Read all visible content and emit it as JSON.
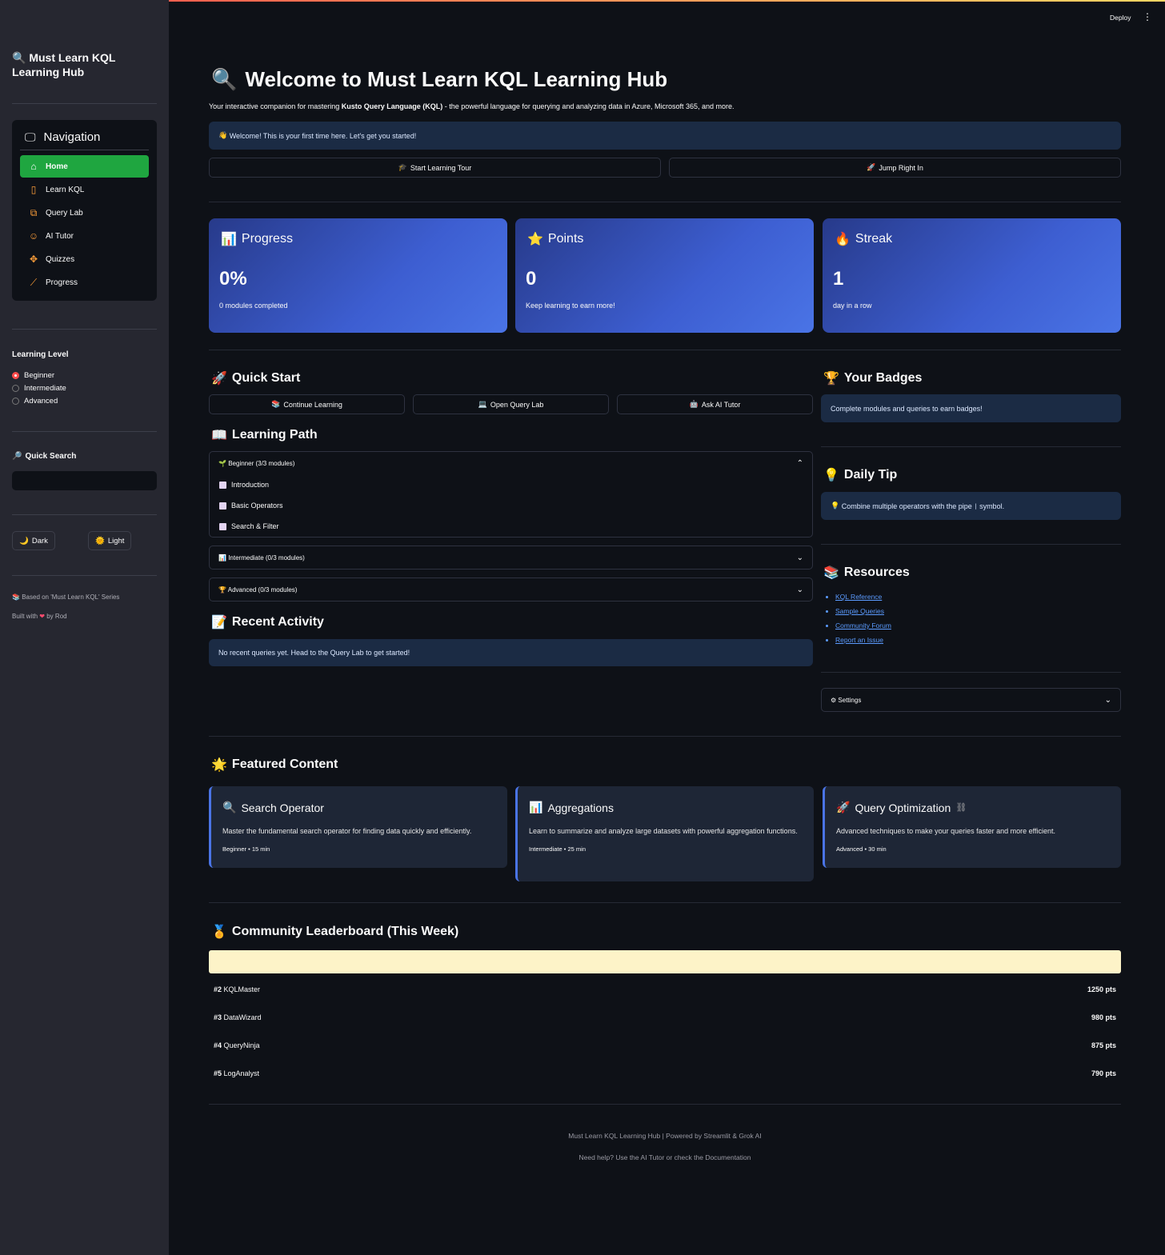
{
  "header": {
    "deploy": "Deploy"
  },
  "sidebar": {
    "title": "Must Learn KQL Learning Hub",
    "nav_title": "Navigation",
    "items": [
      {
        "label": "Home",
        "icon": "home-icon",
        "active": true
      },
      {
        "label": "Learn KQL",
        "icon": "book-icon",
        "active": false
      },
      {
        "label": "Query Lab",
        "icon": "code-icon",
        "active": false
      },
      {
        "label": "AI Tutor",
        "icon": "robot-icon",
        "active": false
      },
      {
        "label": "Quizzes",
        "icon": "puzzle-icon",
        "active": false
      },
      {
        "label": "Progress",
        "icon": "chart-icon",
        "active": false
      }
    ],
    "level_label": "Learning Level",
    "levels": [
      "Beginner",
      "Intermediate",
      "Advanced"
    ],
    "selected_level": "Beginner",
    "search_label": "Quick Search",
    "search_value": "",
    "dark_label": "Dark",
    "light_label": "Light",
    "based_on": "Based on 'Must Learn KQL' Series",
    "built_with_a": "Built with",
    "built_with_b": "by Rod"
  },
  "main": {
    "title": "Welcome to Must Learn KQL Learning Hub",
    "subtitle_a": "Your interactive companion for mastering ",
    "subtitle_b": "Kusto Query Language (KQL)",
    "subtitle_c": " - the powerful language for querying and analyzing data in Azure, Microsoft 365, and more.",
    "welcome": "Welcome! This is your first time here. Let's get you started!",
    "start_tour": "Start Learning Tour",
    "jump_in": "Jump Right In",
    "stats": [
      {
        "title": "Progress",
        "value": "0%",
        "desc": "0 modules completed"
      },
      {
        "title": "Points",
        "value": "0",
        "desc": "Keep learning to earn more!"
      },
      {
        "title": "Streak",
        "value": "1",
        "desc": "day in a row"
      }
    ],
    "quick_start": "Quick Start",
    "qs_buttons": [
      "Continue Learning",
      "Open Query Lab",
      "Ask AI Tutor"
    ],
    "learning_path": "Learning Path",
    "beginner_header": "Beginner (3/3 modules)",
    "beginner_modules": [
      "Introduction",
      "Basic Operators",
      "Search & Filter"
    ],
    "intermediate_header": "Intermediate (0/3 modules)",
    "advanced_header": "Advanced (0/3 modules)",
    "recent_activity": "Recent Activity",
    "recent_msg": "No recent queries yet. Head to the Query Lab to get started!",
    "badges_title": "Your Badges",
    "badges_msg": "Complete modules and queries to earn badges!",
    "tip_title": "Daily Tip",
    "tip_a": "Combine multiple operators with the pipe ",
    "tip_pipe": "|",
    "tip_b": " symbol.",
    "resources_title": "Resources",
    "resources": [
      "KQL Reference",
      "Sample Queries",
      "Community Forum",
      "Report an Issue"
    ],
    "settings": "Settings",
    "featured_title": "Featured Content",
    "featured": [
      {
        "title": "Search Operator",
        "desc": "Master the fundamental search operator for finding data quickly and efficiently.",
        "meta": "Beginner • 15 min"
      },
      {
        "title": "Aggregations",
        "desc": "Learn to summarize and analyze large datasets with powerful aggregation functions.",
        "meta": "Intermediate • 25 min"
      },
      {
        "title": "Query Optimization",
        "desc": "Advanced techniques to make your queries faster and more efficient.",
        "meta": "Advanced • 30 min"
      }
    ],
    "leaderboard_title": "Community Leaderboard (This Week)",
    "leaderboard": [
      {
        "rank": "#2",
        "name": "KQLMaster",
        "pts": "1250 pts"
      },
      {
        "rank": "#3",
        "name": "DataWizard",
        "pts": "980 pts"
      },
      {
        "rank": "#4",
        "name": "QueryNinja",
        "pts": "875 pts"
      },
      {
        "rank": "#5",
        "name": "LogAnalyst",
        "pts": "790 pts"
      }
    ],
    "footer_1": "Must Learn KQL Learning Hub | Powered by Streamlit & Grok AI",
    "footer_2": "Need help? Use the AI Tutor or check the Documentation"
  },
  "colors": {
    "accent_green": "#1fa640",
    "card_blue": "#3d5ed1",
    "link": "#5b9bff",
    "radio_red": "#ff4b4b"
  }
}
